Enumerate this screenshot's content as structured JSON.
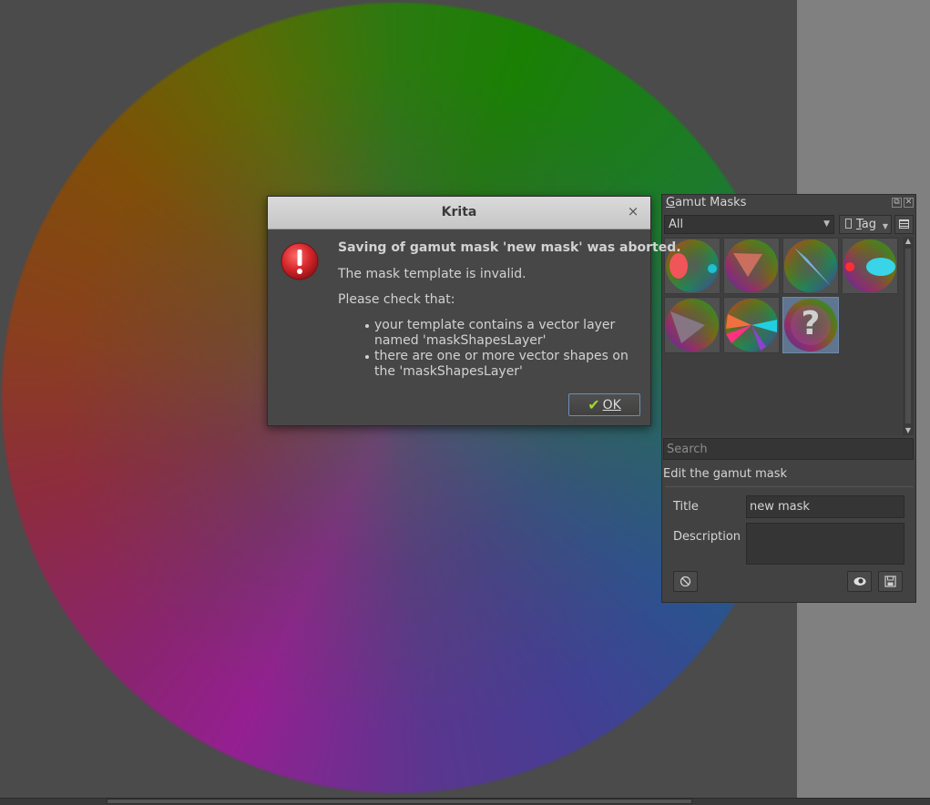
{
  "dialog": {
    "title": "Krita",
    "close_glyph": "×",
    "icon": "error-icon",
    "heading": "Saving of gamut mask 'new mask' was aborted.",
    "message": "The mask template is invalid.",
    "check_intro": "Please check that:",
    "checks": [
      "your template contains a vector layer named 'maskShapesLayer'",
      "there are one or more vector shapes on the 'maskShapesLayer'"
    ],
    "ok_check": "✔",
    "ok_label": "OK"
  },
  "docker": {
    "title_first": "G",
    "title_rest": "amut Masks",
    "filter_value": "All",
    "tag_label_first": "T",
    "tag_label_rest": "ag",
    "search_placeholder": "Search",
    "edit_label": "Edit the gamut mask",
    "title_field_label": "Title",
    "title_field_value": "new mask",
    "description_field_label": "Description",
    "description_field_value": "",
    "masks": [
      {
        "name": "mask-ellipse-dot"
      },
      {
        "name": "mask-triangle"
      },
      {
        "name": "mask-diagonal-shape"
      },
      {
        "name": "mask-dot-ellipse"
      },
      {
        "name": "mask-triangle-wide"
      },
      {
        "name": "mask-atmospheric-triad"
      },
      {
        "name": "mask-new-unknown",
        "selected": true,
        "glyph": "?"
      }
    ]
  },
  "colors": {
    "accent": "#6d8fb5",
    "error_red": "#d4262b",
    "ok_check": "#9fd92c"
  }
}
